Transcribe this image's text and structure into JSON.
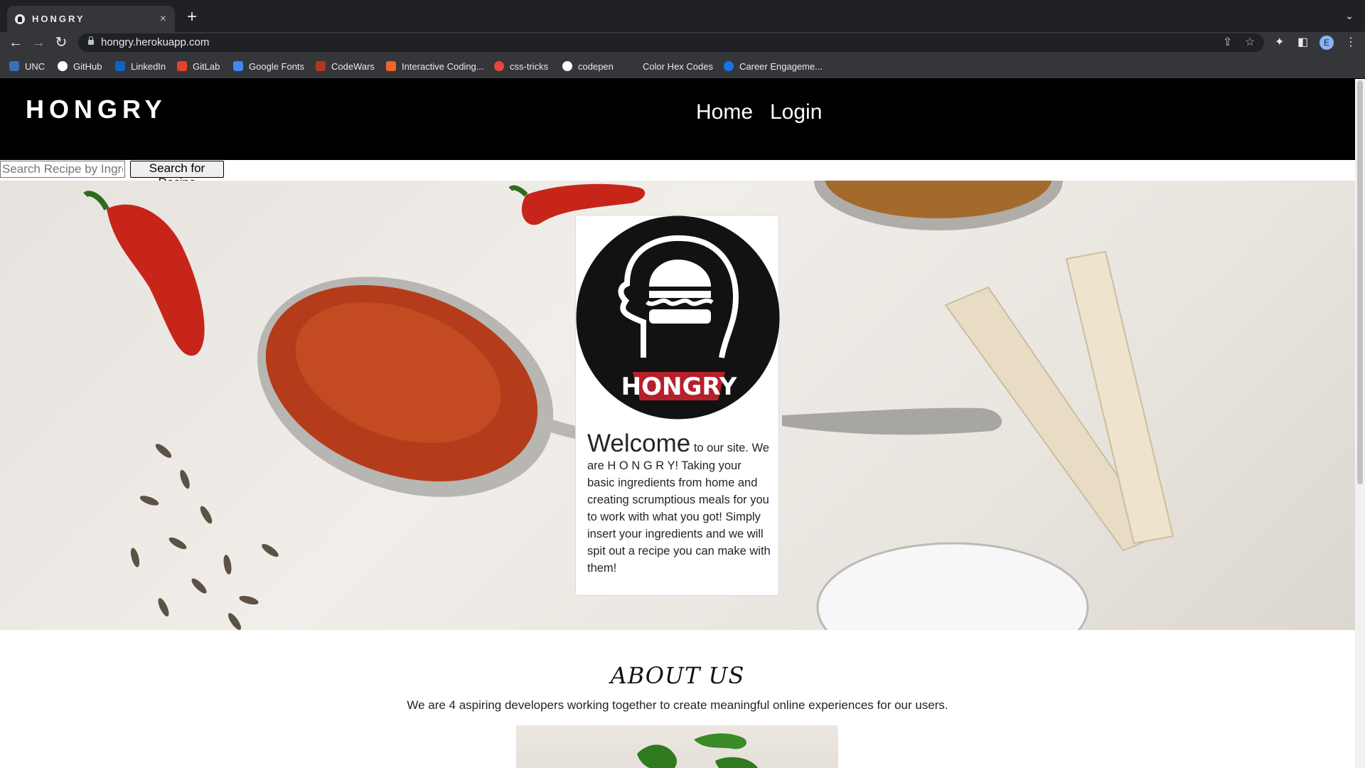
{
  "browser": {
    "tab_title": "HONGRY",
    "tab_close": "×",
    "new_tab": "+",
    "tab_list": "⌄",
    "url": "hongry.herokuapp.com",
    "profile_initial": "E",
    "bookmarks": [
      {
        "label": "UNC",
        "icon": "unc-icon",
        "color": "#3b6fb6"
      },
      {
        "label": "GitHub",
        "icon": "github-icon",
        "color": "#ffffff"
      },
      {
        "label": "LinkedIn",
        "icon": "linkedin-icon",
        "color": "#0a66c2"
      },
      {
        "label": "GitLab",
        "icon": "gitlab-icon",
        "color": "#e2432a"
      },
      {
        "label": "Google Fonts",
        "icon": "google-fonts-icon",
        "color": "#4285f4"
      },
      {
        "label": "CodeWars",
        "icon": "codewars-icon",
        "color": "#b1361e"
      },
      {
        "label": "Interactive Coding...",
        "icon": "interactive-coding-icon",
        "color": "#f06529"
      },
      {
        "label": "css-tricks",
        "icon": "css-tricks-icon",
        "color": "#e8453c"
      },
      {
        "label": "codepen",
        "icon": "codepen-icon",
        "color": "#ffffff"
      },
      {
        "label": "Color Hex Codes",
        "icon": "color-hex-icon",
        "color": "#35363a"
      },
      {
        "label": "Career Engageme...",
        "icon": "career-engagement-icon",
        "color": "#1a73e8"
      }
    ]
  },
  "site": {
    "brand": "HONGRY",
    "nav": {
      "home": "Home",
      "login": "Login"
    },
    "search": {
      "placeholder": "Search Recipe by Ingredient",
      "button": "Search for Recipe"
    },
    "welcome": {
      "headline": "Welcome",
      "body": "to our site. We are H O N G R Y! Taking your basic ingredients from home and creating scrumptious meals for you to work with what you got! Simply insert your ingredients and we will spit out a recipe you can make with them!"
    },
    "logo_text": "HONGRY",
    "about": {
      "title": "ABOUT US",
      "text": "We are 4 aspiring developers working together to create meaningful online experiences for our users."
    }
  },
  "colors": {
    "header_bg": "#000000",
    "logo_red": "#b5202a",
    "chrome_dark": "#202124"
  }
}
